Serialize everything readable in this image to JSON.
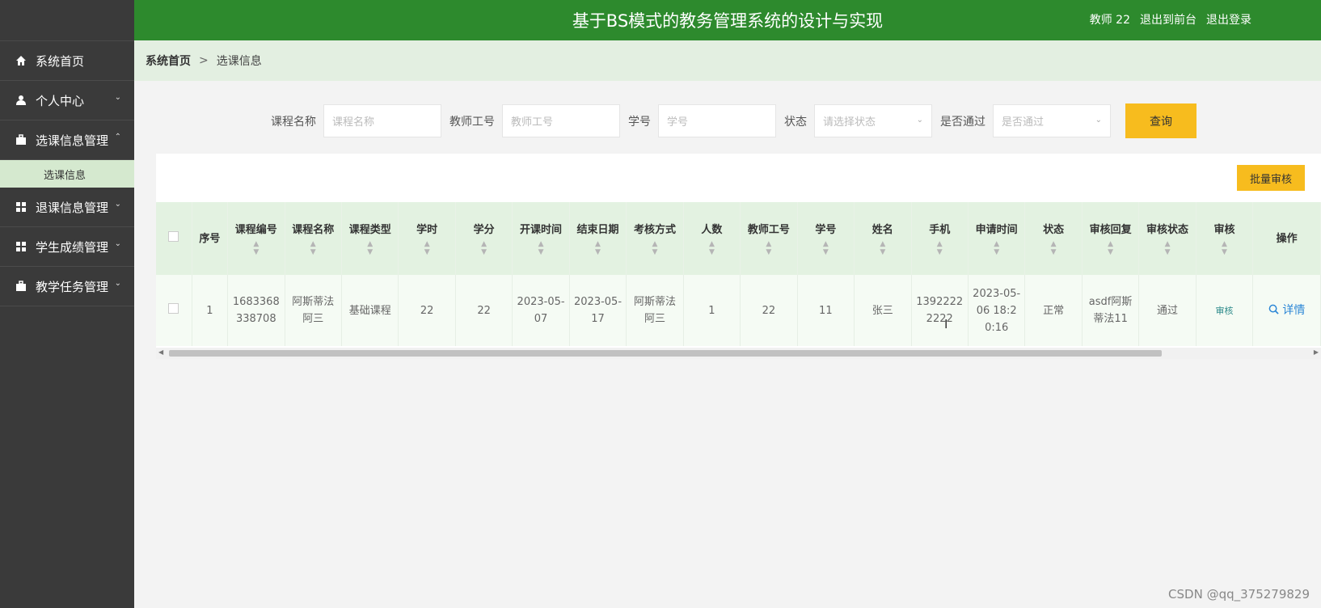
{
  "sidebar": {
    "items": [
      {
        "label": "系统首页",
        "icon": "home-icon"
      },
      {
        "label": "个人中心",
        "icon": "user-icon",
        "expanded": false
      },
      {
        "label": "选课信息管理",
        "icon": "briefcase-icon",
        "expanded": true
      },
      {
        "label": "退课信息管理",
        "icon": "grid-icon",
        "expanded": false
      },
      {
        "label": "学生成绩管理",
        "icon": "grid-icon",
        "expanded": false
      },
      {
        "label": "教学任务管理",
        "icon": "briefcase-icon",
        "expanded": false
      }
    ],
    "subitem": "选课信息"
  },
  "header": {
    "title": "基于BS模式的教务管理系统的设计与实现",
    "user": "教师 22",
    "back_front": "退出到前台",
    "logout": "退出登录"
  },
  "breadcrumb": {
    "home": "系统首页",
    "separator": ">",
    "current": "选课信息"
  },
  "search": {
    "course_name_label": "课程名称",
    "course_name_placeholder": "课程名称",
    "teacher_id_label": "教师工号",
    "teacher_id_placeholder": "教师工号",
    "student_id_label": "学号",
    "student_id_placeholder": "学号",
    "status_label": "状态",
    "status_placeholder": "请选择状态",
    "passed_label": "是否通过",
    "passed_placeholder": "是否通过",
    "query_button": "查询"
  },
  "table": {
    "batch_button": "批量审核",
    "headers": [
      "序号",
      "课程编号",
      "课程名称",
      "课程类型",
      "学时",
      "学分",
      "开课时间",
      "结束日期",
      "考核方式",
      "人数",
      "教师工号",
      "学号",
      "姓名",
      "手机",
      "申请时间",
      "状态",
      "审核回复",
      "审核状态",
      "审核",
      "操作"
    ],
    "rows": [
      {
        "index": "1",
        "course_no": "1683368338708",
        "course_name": "阿斯蒂法阿三",
        "course_type": "基础课程",
        "hours": "22",
        "credits": "22",
        "start": "2023-05-07",
        "end": "2023-05-17",
        "exam": "阿斯蒂法阿三",
        "people": "1",
        "teacher_id": "22",
        "student_id": "11",
        "name": "张三",
        "phone": "13922222222",
        "apply_time": "2023-05-06 18:20:16",
        "status": "正常",
        "reply": "asdf阿斯蒂法11",
        "audit_status": "通过",
        "audit": "审核",
        "detail": "详情"
      }
    ]
  },
  "colors": {
    "header_green": "#2d8a2d",
    "accent_yellow": "#f7bc1e",
    "sidebar": "#3a3a3a"
  },
  "watermark": "CSDN @qq_375279829"
}
